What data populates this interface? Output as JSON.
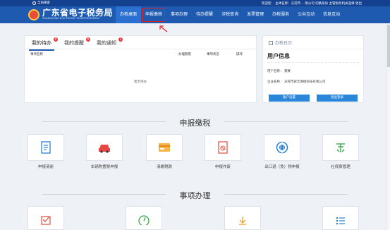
{
  "topbar": {
    "search_label": "全局搜索",
    "user_line": "欢迎您：        主体名称：东莞市…     限公司 切换身份  主管税务机关选择 退出"
  },
  "header": {
    "logo_cn": "广东省电子税务局",
    "logo_en": "GUANGDONG ELECTRONIC TAXATION BUREAU",
    "nav": [
      "办税桌面",
      "申报缴税",
      "事项办理",
      "待办提醒",
      "涉税查询",
      "发票管理",
      "办税服务",
      "公共互动",
      "信息互动"
    ]
  },
  "todo": {
    "tabs": [
      {
        "label": "我的待办",
        "badge": "0"
      },
      {
        "label": "我的提醒",
        "badge": "0"
      },
      {
        "label": "我的通知",
        "badge": "2"
      }
    ],
    "columns": [
      "事项名称",
      "办理期限",
      "事项状态",
      "操作"
    ],
    "empty_text": "暂无待办"
  },
  "user_panel": {
    "calendar_label": "办税日历",
    "title": "用户信息",
    "username_label": "用户名称：",
    "username_value": "黄赛",
    "company_label": "企业名称：",
    "company_value": "东莞市祥丰德缘科技有限公司",
    "btn_settings": "账户设置",
    "btn_logout": "退出登录"
  },
  "section1": {
    "title": "申报缴税",
    "items": [
      "申报清册",
      "车辆购置税申报",
      "清缴税款",
      "申报作废",
      "出口退（免）税申报",
      "社保费管理"
    ]
  },
  "section2": {
    "title": "事项办理"
  },
  "colors": {
    "header_blue": "#1d5ab0",
    "topbar_blue": "#14418f",
    "highlight_red": "#e02020"
  }
}
